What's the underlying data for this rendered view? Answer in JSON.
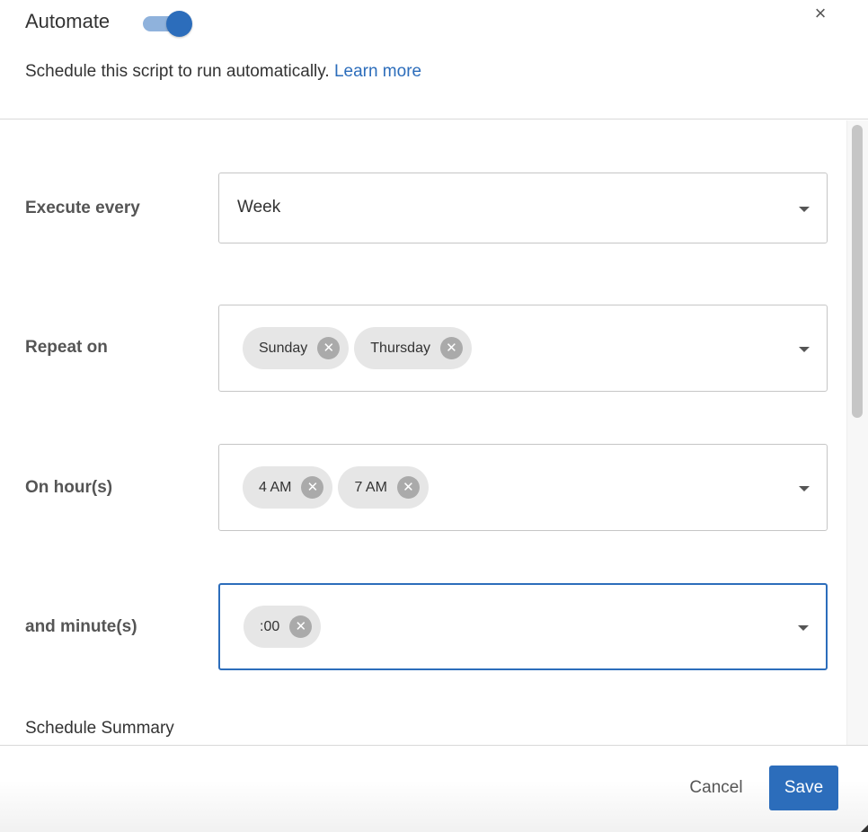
{
  "header": {
    "title": "Automate",
    "toggle_on": true,
    "subtitle": "Schedule this script to run automatically.",
    "learn_more": "Learn more",
    "close_glyph": "×"
  },
  "form": {
    "execute_every": {
      "label": "Execute every",
      "value": "Week"
    },
    "repeat_on": {
      "label": "Repeat on",
      "chips": [
        "Sunday",
        "Thursday"
      ]
    },
    "on_hours": {
      "label": "On hour(s)",
      "chips": [
        "4 AM",
        "7 AM"
      ]
    },
    "minutes": {
      "label": "and minute(s)",
      "chips": [
        ":00"
      ]
    },
    "summary_heading": "Schedule Summary"
  },
  "footer": {
    "cancel_label": "Cancel",
    "save_label": "Save"
  },
  "colors": {
    "accent": "#2c6dbb",
    "toggle_track": "#8fb2dc",
    "chip_bg": "#e6e6e6",
    "border": "#c6c6c6"
  },
  "icons": {
    "close": "close-icon",
    "remove_chip": "remove-chip-icon",
    "dropdown": "chevron-down-icon"
  }
}
